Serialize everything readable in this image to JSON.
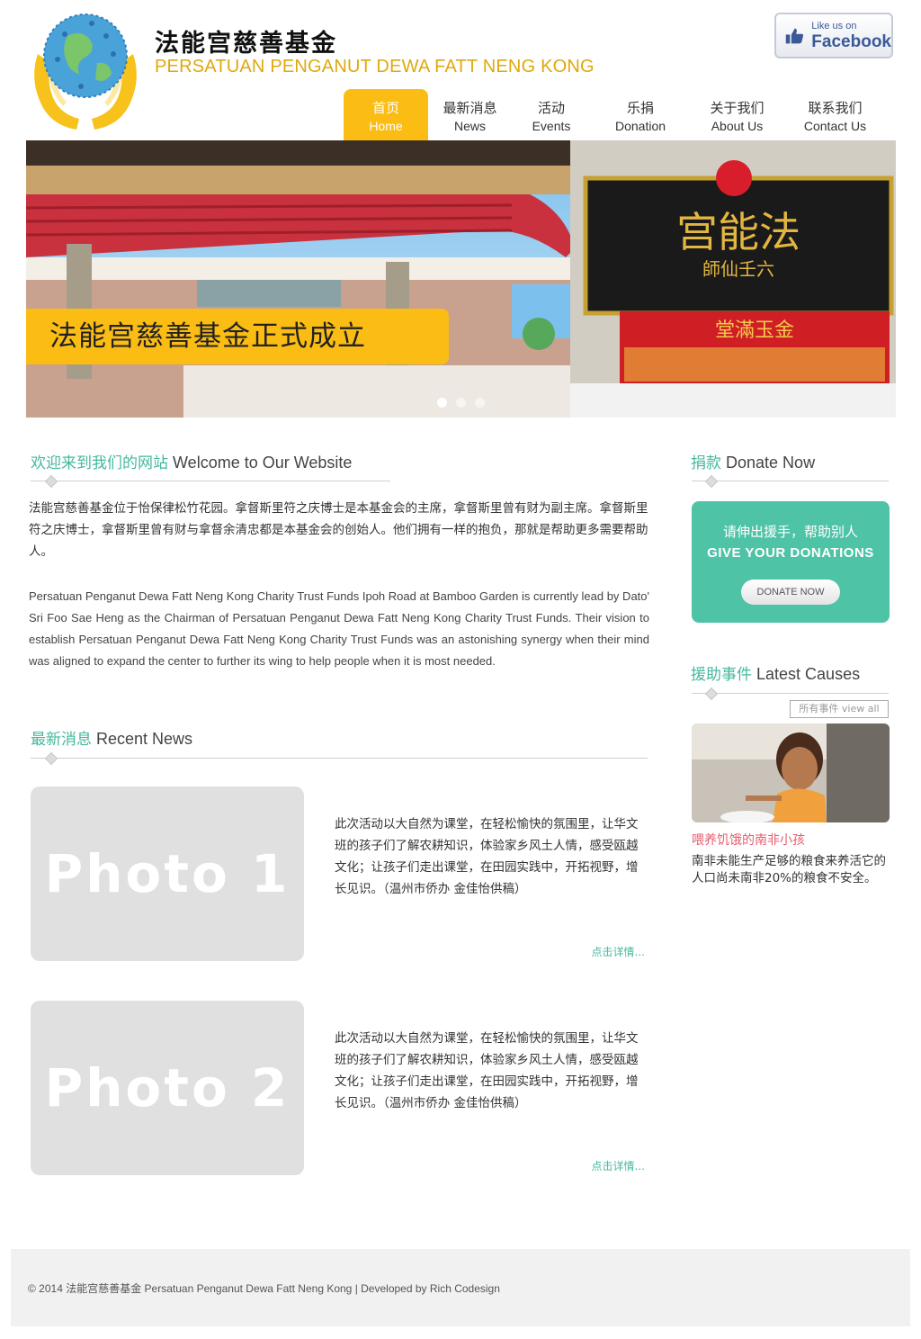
{
  "header": {
    "title_cn": "法能宫慈善基金",
    "title_en": "PERSATUAN PENGANUT DEWA FATT NENG KONG",
    "facebook": {
      "small": "Like us on",
      "brand": "Facebook"
    }
  },
  "nav": [
    {
      "cn": "首页",
      "en": "Home",
      "active": true
    },
    {
      "cn": "最新消息",
      "en": "News"
    },
    {
      "cn": "活动",
      "en": "Events"
    },
    {
      "cn": "乐捐",
      "en": "Donation"
    },
    {
      "cn": "关于我们",
      "en": "About Us"
    },
    {
      "cn": "联系我们",
      "en": "Contact Us"
    }
  ],
  "slider": {
    "caption": "法能宫慈善基金正式成立",
    "signboard": "宫能法",
    "signboard_sub": "師仙壬六",
    "banner": "堂滿玉金",
    "dots": 3,
    "active_dot": 1
  },
  "welcome": {
    "heading_cn": "欢迎来到我们的网站",
    "heading_en": "Welcome to Our Website",
    "text_cn": "法能宫慈善基金位于怡保律松竹花园。拿督斯里符之庆博士是本基金会的主席，拿督斯里曾有财为副主席。拿督斯里符之庆博士，拿督斯里曾有财与拿督余清忠都是本基金会的创始人。他们拥有一样的抱负，那就是帮助更多需要帮助人。",
    "text_en": "Persatuan Penganut Dewa Fatt Neng Kong Charity Trust Funds Ipoh Road at Bamboo Garden is currently lead by Dato' Sri Foo Sae Heng as the Chairman of Persatuan Penganut Dewa Fatt Neng Kong Charity Trust Funds. Their vision to establish Persatuan Penganut Dewa Fatt Neng Kong Charity Trust Funds  was an astonishing synergy when their mind was aligned to expand the center to further its wing to help people when it is most needed."
  },
  "news": {
    "heading_cn": "最新消息",
    "heading_en": "Recent News",
    "items": [
      {
        "photo": "Photo 1",
        "text": "此次活动以大自然为课堂，在轻松愉快的氛围里，让华文班的孩子们了解农耕知识，体验家乡风土人情，感受瓯越文化；让孩子们走出课堂，在田园实践中，开拓视野，增长见识。（温州市侨办 金佳怡供稿）",
        "more": "点击详情..."
      },
      {
        "photo": "Photo 2",
        "text": "此次活动以大自然为课堂，在轻松愉快的氛围里，让华文班的孩子们了解农耕知识，体验家乡风土人情，感受瓯越文化；让孩子们走出课堂，在田园实践中，开拓视野，增长见识。（温州市侨办 金佳怡供稿）",
        "more": "点击详情..."
      }
    ]
  },
  "donate": {
    "heading_cn": "捐款",
    "heading_en": "Donate Now",
    "line_cn": "请伸出援手，帮助别人",
    "line_en": "GIVE YOUR DONATIONS",
    "button": "DONATE NOW"
  },
  "causes": {
    "heading_cn": "援助事件",
    "heading_en": "Latest Causes",
    "view_all": "所有事件   view all",
    "title": "喂养饥饿的南非小孩",
    "text": "南非未能生产足够的粮食来养活它的人口尚未南非20%的粮食不安全。"
  },
  "footer": {
    "text": "© 2014 法能宫慈善基金  Persatuan Penganut Dewa Fatt Neng Kong  |    Developed by Rich Codesign"
  },
  "colors": {
    "accent_yellow": "#fbbd14",
    "accent_teal": "#4fc3a6",
    "heading_teal": "#45b89f",
    "cause_red": "#e75d6e"
  }
}
